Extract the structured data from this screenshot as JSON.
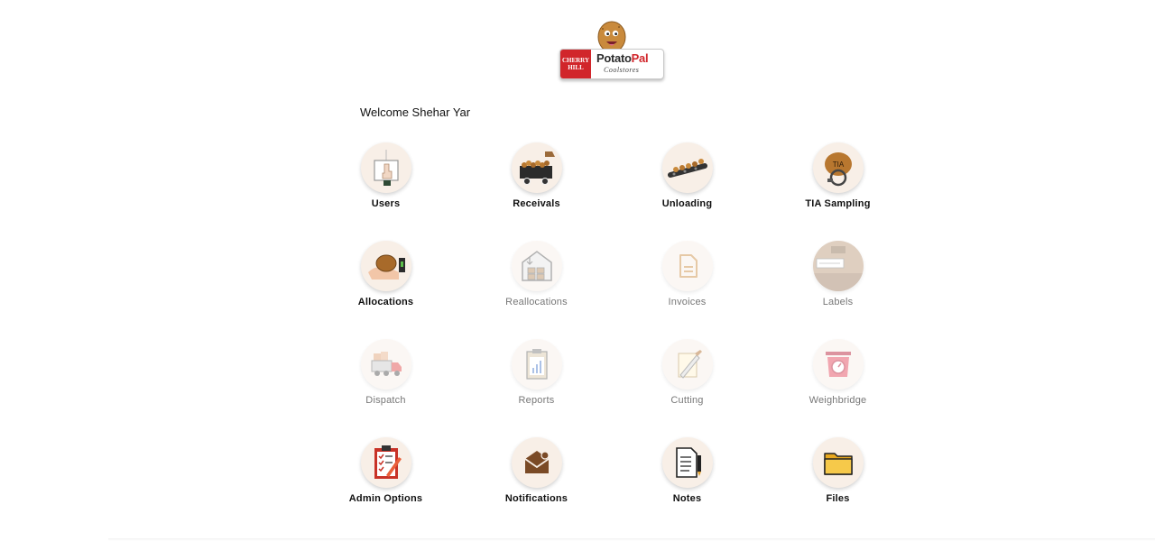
{
  "logo": {
    "left_text": "CHERRY HILL",
    "title_main": "Potato",
    "title_accent": "Pal",
    "subtitle": "Coolstores"
  },
  "welcome": "Welcome Shehar Yar",
  "tiles": [
    {
      "label": "Users",
      "icon": "users-icon",
      "enabled": true
    },
    {
      "label": "Receivals",
      "icon": "receivals-cart-icon",
      "enabled": true
    },
    {
      "label": "Unloading",
      "icon": "conveyor-icon",
      "enabled": true
    },
    {
      "label": "TIA Sampling",
      "icon": "tia-sampling-icon",
      "enabled": true
    },
    {
      "label": "Allocations",
      "icon": "allocations-hand-icon",
      "enabled": true
    },
    {
      "label": "Reallocations",
      "icon": "warehouse-icon",
      "enabled": false
    },
    {
      "label": "Invoices",
      "icon": "invoice-icon",
      "enabled": false
    },
    {
      "label": "Labels",
      "icon": "label-box-icon",
      "enabled": false
    },
    {
      "label": "Dispatch",
      "icon": "truck-icon",
      "enabled": false
    },
    {
      "label": "Reports",
      "icon": "report-clipboard-icon",
      "enabled": false
    },
    {
      "label": "Cutting",
      "icon": "cutting-knife-icon",
      "enabled": false
    },
    {
      "label": "Weighbridge",
      "icon": "scale-icon",
      "enabled": false
    },
    {
      "label": "Admin Options",
      "icon": "checklist-icon",
      "enabled": true
    },
    {
      "label": "Notifications",
      "icon": "envelope-icon",
      "enabled": true
    },
    {
      "label": "Notes",
      "icon": "notes-pen-icon",
      "enabled": true
    },
    {
      "label": "Files",
      "icon": "folder-icon",
      "enabled": true
    }
  ],
  "colors": {
    "brand_red": "#d1262b",
    "potato": "#c98a3c",
    "circle_bg": "#f8efe7"
  }
}
